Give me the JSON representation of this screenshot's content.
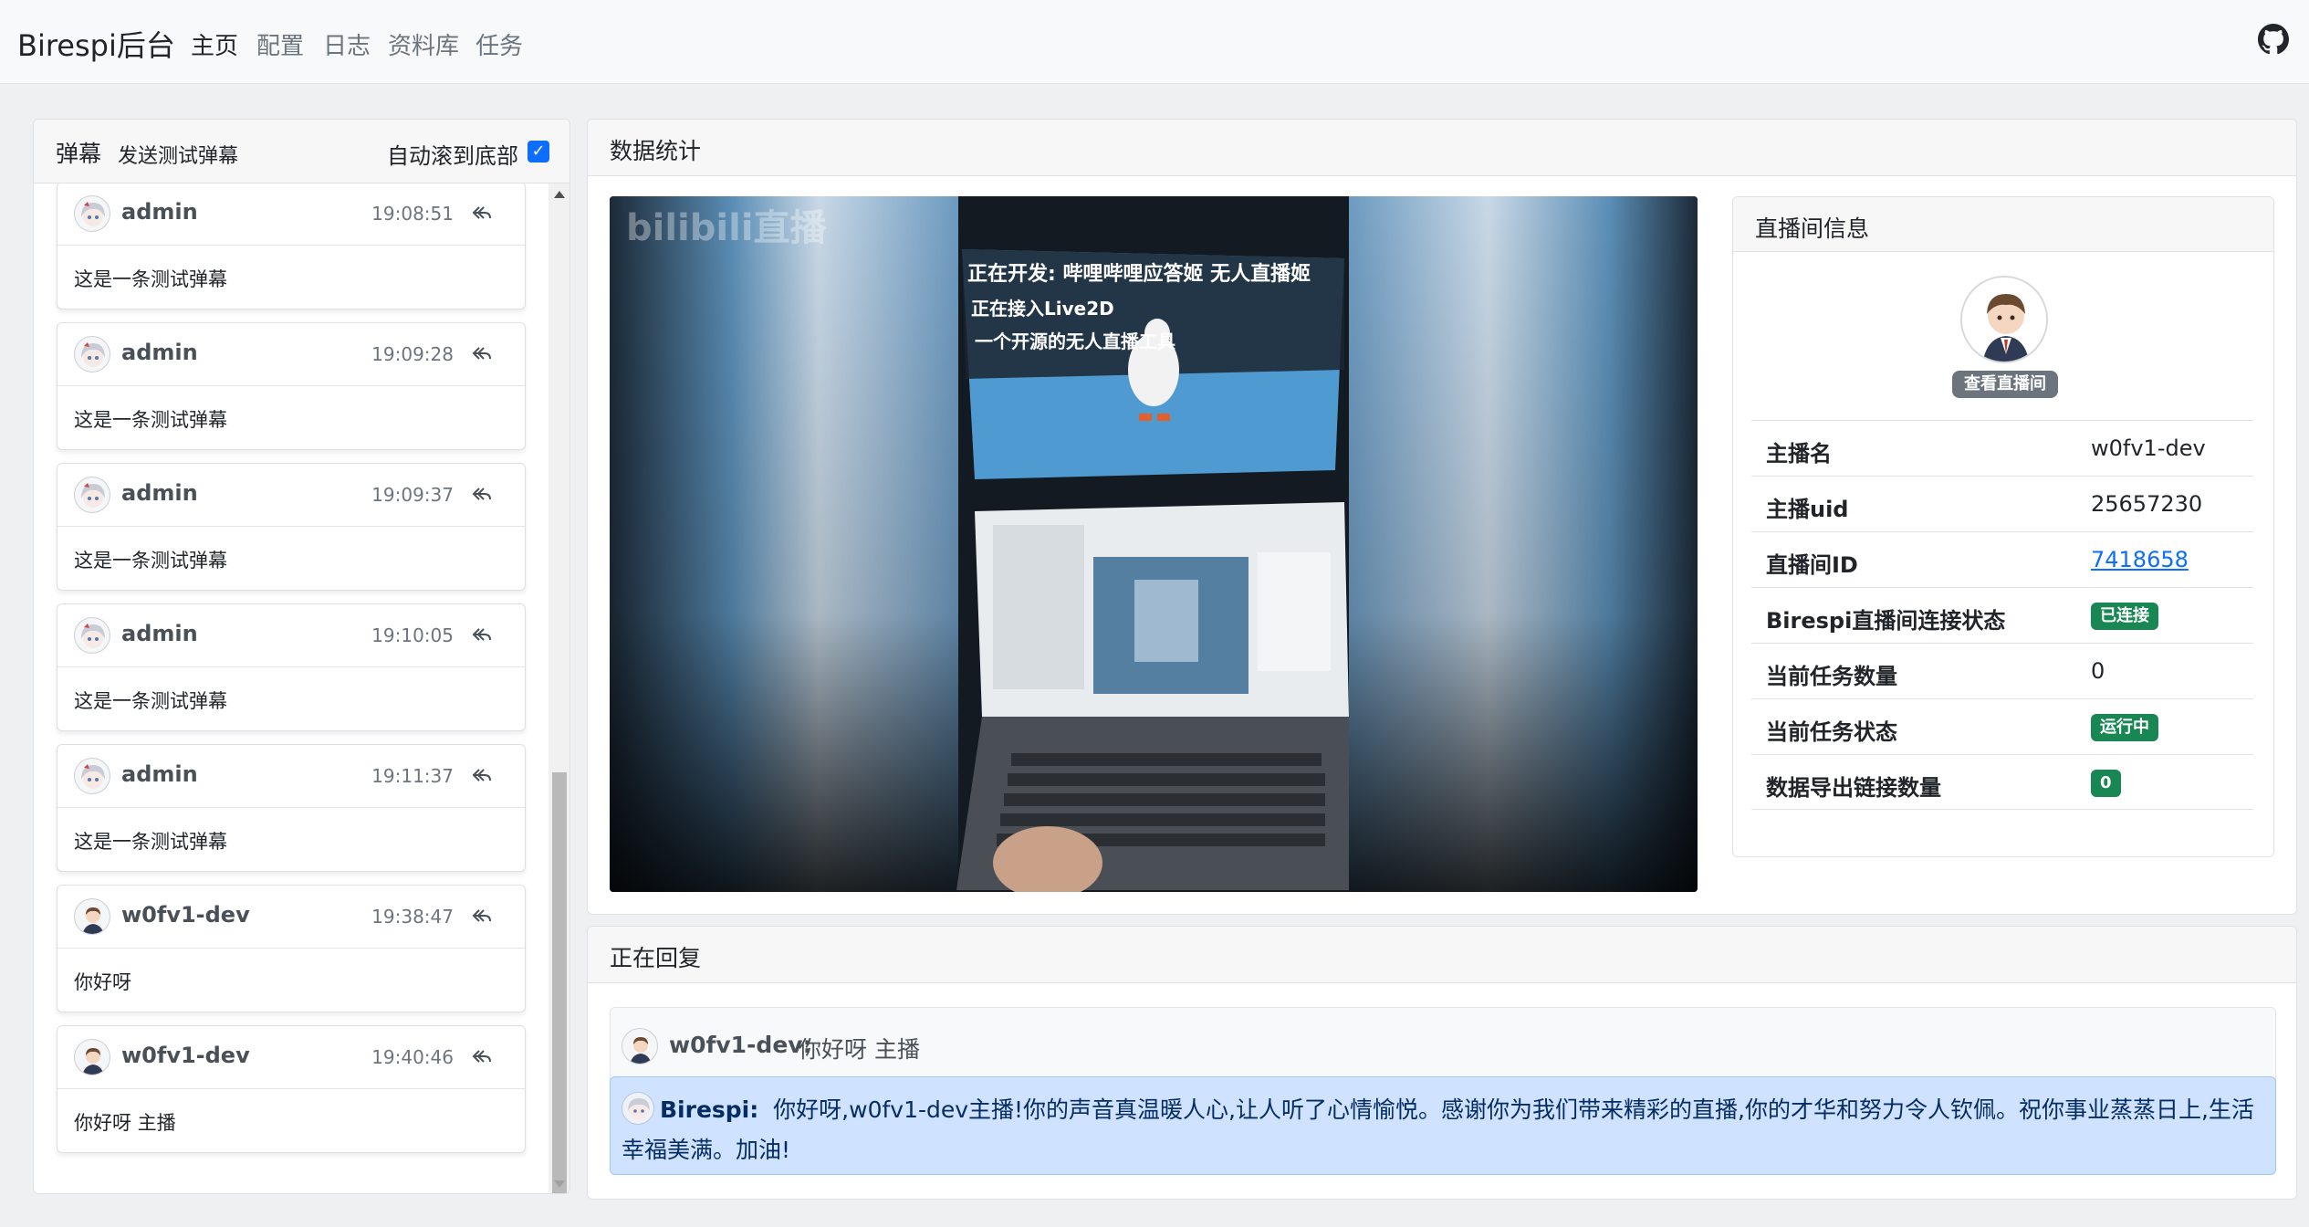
{
  "navbar": {
    "brand": "Birespi后台",
    "links": [
      "主页",
      "配置",
      "日志",
      "资料库",
      "任务"
    ],
    "active_index": 0
  },
  "danmaku": {
    "title": "弹幕",
    "send_test": "发送测试弹幕",
    "auto_scroll_label": "自动滚到底部",
    "auto_scroll_checked": true,
    "messages": [
      {
        "user": "admin",
        "time": "19:08:51",
        "text": "这是一条测试弹幕",
        "avatar": "anime-girl-avatar-icon"
      },
      {
        "user": "admin",
        "time": "19:09:28",
        "text": "这是一条测试弹幕",
        "avatar": "anime-girl-avatar-icon"
      },
      {
        "user": "admin",
        "time": "19:09:37",
        "text": "这是一条测试弹幕",
        "avatar": "anime-girl-avatar-icon"
      },
      {
        "user": "admin",
        "time": "19:10:05",
        "text": "这是一条测试弹幕",
        "avatar": "anime-girl-avatar-icon"
      },
      {
        "user": "admin",
        "time": "19:11:37",
        "text": "这是一条测试弹幕",
        "avatar": "anime-girl-avatar-icon"
      },
      {
        "user": "w0fv1-dev",
        "time": "19:38:47",
        "text": "你好呀",
        "avatar": "suit-boy-avatar-icon"
      },
      {
        "user": "w0fv1-dev",
        "time": "19:40:46",
        "text": "你好呀 主播",
        "avatar": "suit-boy-avatar-icon"
      }
    ]
  },
  "stats": {
    "title": "数据统计",
    "stream": {
      "watermark": "bilibili直播",
      "overlay_lines": [
        "正在开发: 哔哩哔哩应答姬 无人直播姬",
        "正在接入Live2D",
        "一个开源的无人直播工具"
      ]
    }
  },
  "room_info": {
    "title": "直播间信息",
    "view_room": "查看直播间",
    "rows": [
      {
        "key": "主播名",
        "value": "w0fv1-dev",
        "kind": "text"
      },
      {
        "key": "主播uid",
        "value": "25657230",
        "kind": "text"
      },
      {
        "key": "直播间ID",
        "value": "7418658",
        "kind": "link"
      },
      {
        "key": "Birespi直播间连接状态",
        "value": "已连接",
        "kind": "badge"
      },
      {
        "key": "当前任务数量",
        "value": "0",
        "kind": "text"
      },
      {
        "key": "当前任务状态",
        "value": "运行中",
        "kind": "badge"
      },
      {
        "key": "数据导出链接数量",
        "value": "0",
        "kind": "badge"
      }
    ]
  },
  "replying": {
    "title": "正在回复",
    "user_name": "w0fv1-dev:",
    "user_text": "你好呀 主播",
    "bot_name": "Birespi:",
    "bot_text": "你好呀,w0fv1-dev主播!你的声音真温暖人心,让人听了心情愉悦。感谢你为我们带来精彩的直播,你的才华和努力令人钦佩。祝你事业蒸蒸日上,生活幸福美满。加油!"
  },
  "colors": {
    "primary": "#0d6efd",
    "success": "#198754",
    "secondary": "#6c757d",
    "info_bg": "#cfe2ff"
  }
}
